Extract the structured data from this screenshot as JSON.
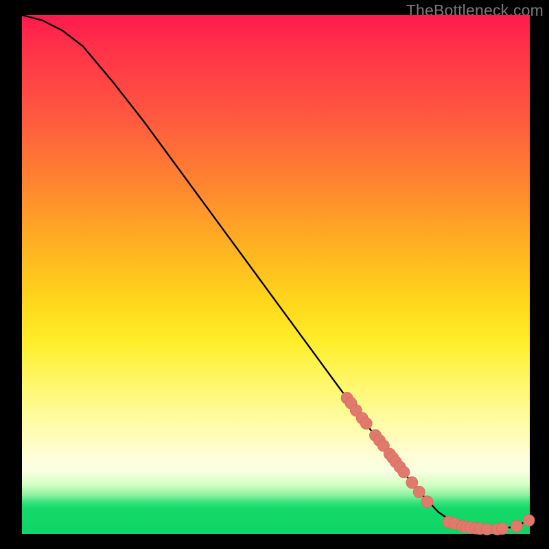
{
  "watermark": "TheBottleneck.com",
  "colors": {
    "curve_stroke": "#000000",
    "marker_fill": "#e07a6d",
    "marker_stroke": "#d96a5b"
  },
  "chart_data": {
    "type": "line",
    "title": "",
    "xlabel": "",
    "ylabel": "",
    "xlim": [
      0,
      100
    ],
    "ylim": [
      0,
      100
    ],
    "grid": false,
    "legend": false,
    "series": [
      {
        "name": "curve",
        "kind": "line",
        "x": [
          0,
          4,
          8,
          12,
          18,
          24,
          30,
          36,
          42,
          48,
          54,
          60,
          66,
          72,
          78,
          82,
          85,
          88,
          91,
          94,
          97,
          100
        ],
        "y": [
          100,
          99,
          97,
          94,
          87,
          79.5,
          71.5,
          63.5,
          55.5,
          47.5,
          39.5,
          31.5,
          23.5,
          15.7,
          8.4,
          4.2,
          2.2,
          1.2,
          0.8,
          0.9,
          1.4,
          2.7
        ]
      },
      {
        "name": "markers-slope",
        "kind": "scatter",
        "x": [
          64.0,
          64.8,
          65.8,
          67.0,
          67.8,
          69.6,
          70.4,
          71.2,
          72.4,
          73.0,
          73.6,
          74.4,
          75.2,
          76.8,
          78.2,
          79.8
        ],
        "y": [
          26.2,
          25.2,
          23.8,
          22.3,
          21.3,
          19.0,
          18.0,
          17.0,
          15.4,
          14.7,
          13.9,
          12.9,
          11.9,
          9.9,
          8.1,
          6.2
        ]
      },
      {
        "name": "markers-trough",
        "kind": "scatter",
        "x": [
          84.0,
          85.2,
          86.8,
          87.6,
          88.4,
          89.4,
          90.2,
          91.6,
          93.6,
          94.6,
          97.4,
          99.8
        ],
        "y": [
          2.3,
          2.0,
          1.5,
          1.3,
          1.2,
          1.1,
          1.0,
          0.9,
          0.9,
          1.0,
          1.5,
          2.6
        ]
      }
    ]
  }
}
